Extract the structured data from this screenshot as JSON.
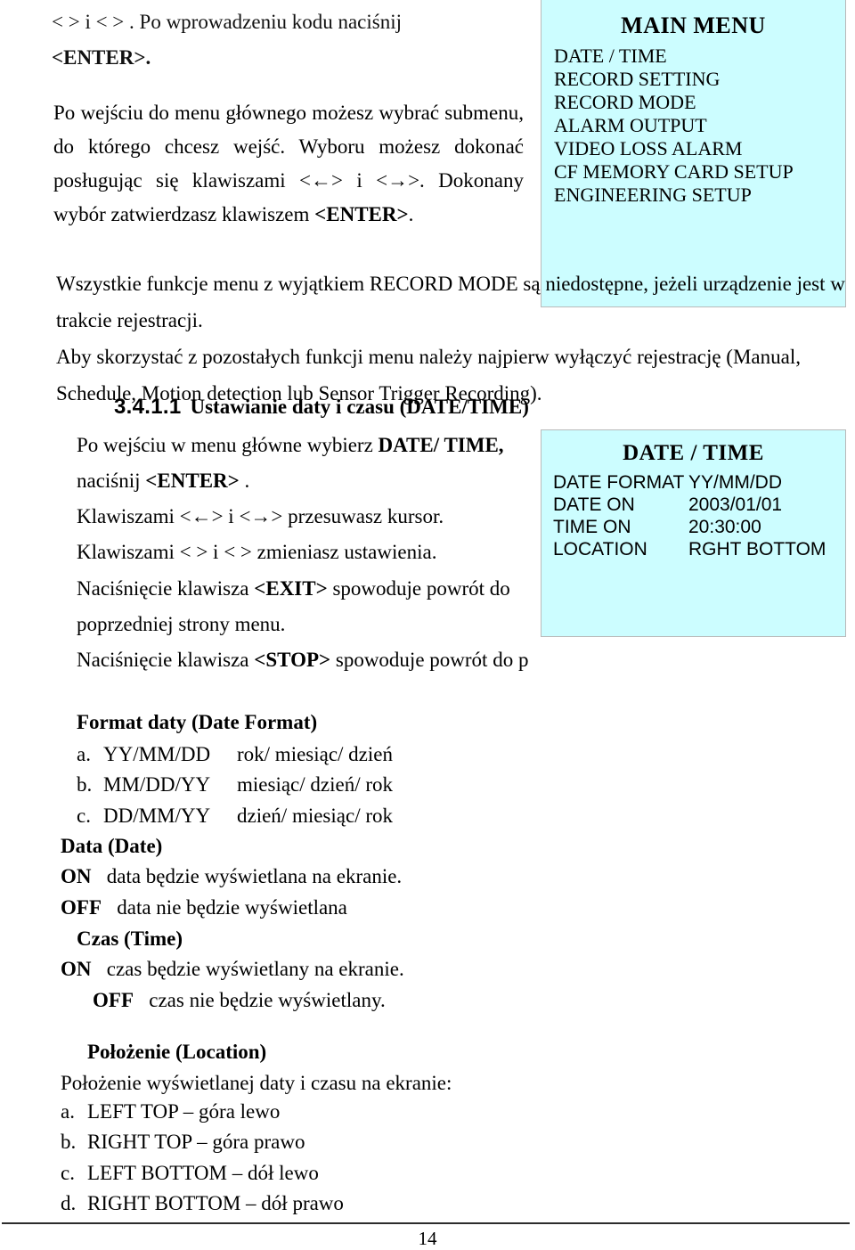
{
  "document": {
    "page_number": "14",
    "osd_panel_color": "#ccfdff"
  },
  "intro": {
    "line_code_1": "<  > i <  > . Po wprowadzeniu kodu naciśnij",
    "line_code_2": "<ENTER>.",
    "paragraph_1_a": "Po wejściu do menu głównego możesz wybrać submenu, do którego chcesz wejść. Wyboru możesz dokonać posługując się klawiszami ",
    "paragraph_1_keys": "<←> i <→>.",
    "paragraph_1_b": " Dokonany wybór zatwierdzasz klawiszem ",
    "paragraph_1_enter": "<ENTER>",
    "paragraph_1_c": "."
  },
  "main_menu_panel": {
    "title": "MAIN MENU",
    "items": [
      "DATE / TIME",
      "RECORD SETTING",
      "RECORD MODE",
      "ALARM OUTPUT",
      "VIDEO LOSS ALARM",
      "CF MEMORY CARD SETUP",
      "ENGINEERING SETUP"
    ]
  },
  "notes": {
    "note_1": "Wszystkie funkcje menu z wyjątkiem RECORD MODE są niedostępne, jeżeli urządzenie jest w trakcie rejestracji.",
    "note_2": "Aby skorzystać z pozostałych funkcji menu należy najpierw wyłączyć rejestrację (Manual, Schedule, Motion detection lub Sensor Trigger Recording)."
  },
  "section": {
    "number": "3.4.1.1",
    "title": "Ustawianie daty i czasu (DATE/TIME)"
  },
  "instructions": {
    "line_1_a": "Po wejściu w menu główne wybierz ",
    "line_1_b": "DATE/ TIME,",
    "line_2_a": "naciśnij ",
    "line_2_b": "<ENTER>",
    "line_2_c": " .",
    "line_3": "Klawiszami <←> i <→> przesuwasz kursor.",
    "line_4": "Klawiszami <  > i <  > zmieniasz ustawienia.",
    "line_5_a": "Naciśnięcie klawisza ",
    "line_5_b": "<EXIT>",
    "line_5_c": " spowoduje powrót do",
    "line_6": "poprzedniej strony menu.",
    "line_7_a": "Naciśnięcie klawisza ",
    "line_7_b": "<STOP>",
    "line_7_c": " spowoduje powrót do p"
  },
  "date_time_panel": {
    "title": "DATE / TIME",
    "rows": [
      {
        "key": "DATE FORMAT",
        "value": "YY/MM/DD"
      },
      {
        "key": "DATE ON",
        "value": "2003/01/01"
      },
      {
        "key": "TIME ON",
        "value": "20:30:00"
      },
      {
        "key": "LOCATION",
        "value": "RGHT BOTTOM"
      }
    ]
  },
  "date_format_section": {
    "heading": "Format daty (Date Format)",
    "options": [
      {
        "marker": "a.",
        "code": "YY/MM/DD",
        "desc": "rok/ miesiąc/ dzień"
      },
      {
        "marker": "b.",
        "code": "MM/DD/YY",
        "desc": "miesiąc/ dzień/ rok"
      },
      {
        "marker": "c.",
        "code": "DD/MM/YY",
        "desc": "dzień/ miesiąc/ rok"
      }
    ]
  },
  "date_section": {
    "heading": "Data (Date)",
    "on_label": "ON",
    "on_desc": "data będzie wyświetlana na ekranie.",
    "off_label": "OFF",
    "off_desc": "data nie będzie wyświetlana"
  },
  "time_section": {
    "heading": "Czas (Time)",
    "on_label": "ON",
    "on_desc": "czas będzie wyświetlany na ekranie.",
    "off_label": "OFF",
    "off_desc": "czas nie będzie wyświetlany."
  },
  "location_section": {
    "heading": "Położenie (Location)",
    "intro": "Położenie wyświetlanej daty i czasu na ekranie:",
    "options": [
      {
        "marker": "a.",
        "text": "LEFT TOP – góra lewo"
      },
      {
        "marker": "b.",
        "text": "RIGHT TOP – góra prawo"
      },
      {
        "marker": "c.",
        "text": "LEFT BOTTOM – dół lewo"
      },
      {
        "marker": "d.",
        "text": "RIGHT BOTTOM – dół prawo"
      }
    ]
  }
}
